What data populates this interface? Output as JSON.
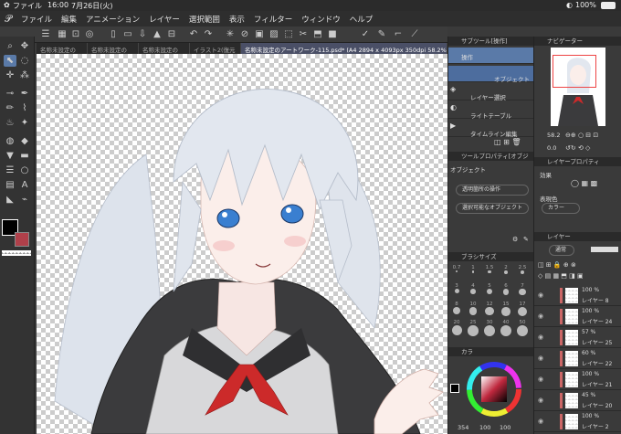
{
  "status": {
    "app": "ファイル",
    "time": "16:00",
    "date": "7月26日(火)",
    "battery": "100%"
  },
  "menu": [
    "ファイル",
    "編集",
    "アニメーション",
    "レイヤー",
    "選択範囲",
    "表示",
    "フィルター",
    "ウィンドウ",
    "ヘルプ"
  ],
  "tabs": [
    "名称未設定の",
    "名称未設定の",
    "名称未設定の",
    "イラスト2(復元",
    "名称未設定のアートワーク-115.psd* (A4 2894 x 4093px 350dpi 58.2%)"
  ],
  "subtool": {
    "header": "サブツール[操作]",
    "items": [
      "操作",
      "オブジェクト",
      "レイヤー選択",
      "ライトテーブル",
      "タイムライン編集"
    ]
  },
  "toolprop": {
    "header": "ツールプロパティ[オブジ",
    "title": "オブジェクト",
    "opt1": "透明箇所の操作",
    "opt2": "選択可能なオブジェクト"
  },
  "brushsize": {
    "header": "ブラシサイズ",
    "values": [
      "0.7",
      "1",
      "1.5",
      "2",
      "2.5",
      "3",
      "4",
      "5",
      "6",
      "7",
      "8",
      "10",
      "12",
      "15",
      "17",
      "20",
      "25",
      "30",
      "40",
      "50"
    ]
  },
  "color": {
    "header": "カラ",
    "footer": "354",
    "v1": "100",
    "v2": "100"
  },
  "navigator": {
    "header": "ナビゲーター",
    "zoom": "58.2",
    "angle": "0.0"
  },
  "layerprop": {
    "header": "レイヤープロパティ",
    "effect": "効果",
    "color_label": "表現色",
    "color_value": "カラー"
  },
  "layers": {
    "header": "レイヤー",
    "blend": "通常",
    "items": [
      {
        "pct": "100 %",
        "name": "レイヤー 8"
      },
      {
        "pct": "100 %",
        "name": "レイヤー 24"
      },
      {
        "pct": "57 %",
        "name": "レイヤー 25"
      },
      {
        "pct": "60 %",
        "name": "レイヤー 22"
      },
      {
        "pct": "100 %",
        "name": "レイヤー 21"
      },
      {
        "pct": "45 %",
        "name": "レイヤー 20"
      },
      {
        "pct": "100 %",
        "name": "レイヤー 2"
      }
    ]
  },
  "accent": "#5a7aa8"
}
